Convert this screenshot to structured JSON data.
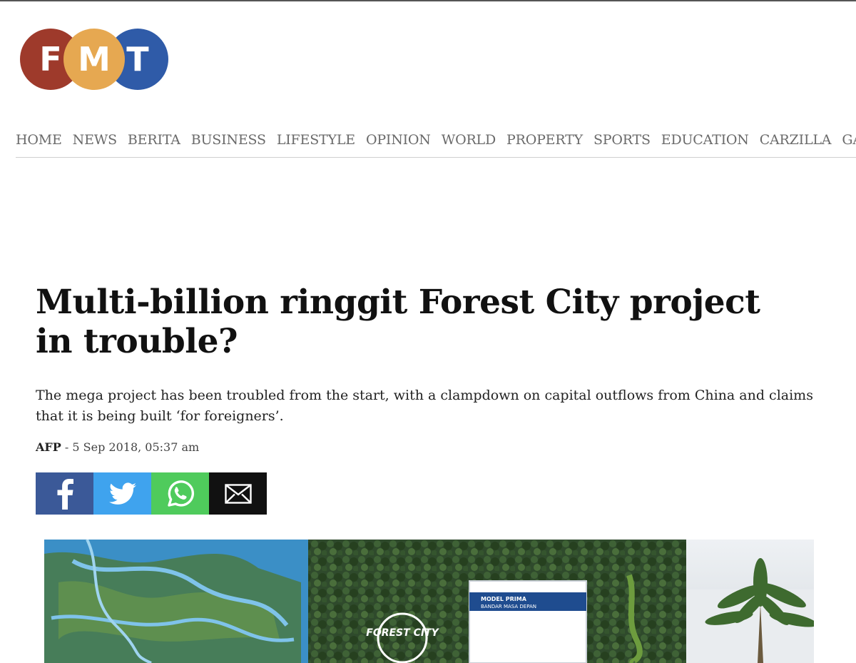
{
  "logo": {
    "letters": [
      "F",
      "M",
      "T"
    ]
  },
  "nav": {
    "items": [
      "HOME",
      "NEWS",
      "BERITA",
      "BUSINESS",
      "LIFESTYLE",
      "OPINION",
      "WORLD",
      "PROPERTY",
      "SPORTS",
      "EDUCATION",
      "CARZILLA",
      "GA"
    ]
  },
  "article": {
    "headline": "Multi-billion ringgit Forest City project in trouble?",
    "standfirst": "The mega project has been troubled from the start, with a clampdown on capital outflows from China and claims that it is being built ‘for foreigners’.",
    "source": "AFP",
    "separator": " - ",
    "date": "5 Sep 2018, 05:37 am"
  },
  "share": {
    "icons": [
      "facebook-icon",
      "twitter-icon",
      "whatsapp-icon",
      "email-icon"
    ]
  },
  "hero": {
    "sign_text": "FOREST CITY",
    "panel_line1": "MODEL PRIMA",
    "panel_line2": "BANDAR MASA DEPAN"
  },
  "colors": {
    "logo_f": "#9e3a2b",
    "logo_m": "#e6a851",
    "logo_t": "#2f5ba8",
    "facebook": "#3b5998",
    "twitter": "#3fa3ee",
    "whatsapp": "#4fcb5c",
    "email": "#111111"
  }
}
